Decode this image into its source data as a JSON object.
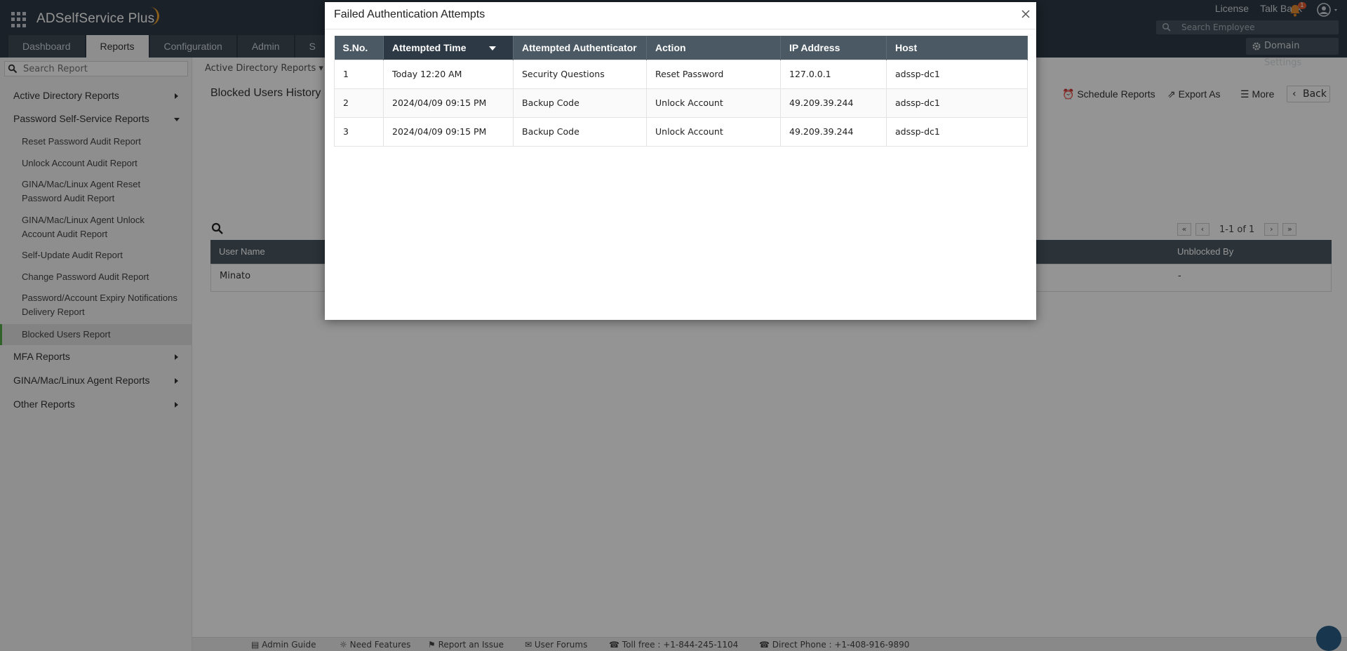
{
  "app": {
    "brand": "ADSelfService Plus"
  },
  "nav": {
    "tabs": [
      {
        "label": "Dashboard"
      },
      {
        "label": "Reports"
      },
      {
        "label": "Configuration"
      },
      {
        "label": "Admin"
      },
      {
        "label": "S"
      }
    ]
  },
  "top_links": {
    "license": "License",
    "talk_back": "Talk Back",
    "notification_count": "1"
  },
  "employee_search": {
    "placeholder": "Search Employee"
  },
  "domain_settings": {
    "label": "Domain Settings"
  },
  "sidebar": {
    "search_placeholder": "Search Report",
    "items": [
      {
        "label": "Active Directory Reports"
      },
      {
        "label": "Password Self-Service Reports"
      },
      {
        "label": "Reset Password Audit Report"
      },
      {
        "label": "Unlock Account Audit Report"
      },
      {
        "label": "GINA/Mac/Linux Agent Reset Password Audit Report"
      },
      {
        "label": "GINA/Mac/Linux Agent Unlock Account Audit Report"
      },
      {
        "label": "Self-Update Audit Report"
      },
      {
        "label": "Change Password Audit Report"
      },
      {
        "label": "Password/Account Expiry Notifications Delivery Report"
      },
      {
        "label": "Blocked Users Report"
      },
      {
        "label": "MFA Reports"
      },
      {
        "label": "GINA/Mac/Linux Agent Reports"
      },
      {
        "label": "Other Reports"
      }
    ]
  },
  "main": {
    "breadcrumb": "Active Directory Reports",
    "title": "Blocked Users History",
    "actions": {
      "schedule": "Schedule Reports",
      "export": "Export As",
      "more": "More",
      "back": "Back"
    },
    "pager": {
      "count": "1-1 of 1"
    },
    "columns": {
      "user_name": "User Name",
      "unblocked_by": "Unblocked By"
    },
    "rows": [
      {
        "user_name": "Minato",
        "unblocked_by": "-"
      }
    ]
  },
  "footer": {
    "admin_guide": "Admin Guide",
    "need_features": "Need Features",
    "report_issue": "Report an Issue",
    "user_forums": "User Forums",
    "toll_free": "Toll free : +1-844-245-1104",
    "direct_phone": "Direct Phone : +1-408-916-9890"
  },
  "modal": {
    "title": "Failed Authentication Attempts",
    "columns": [
      "S.No.",
      "Attempted Time",
      "Attempted Authenticator",
      "Action",
      "IP Address",
      "Host"
    ],
    "rows": [
      [
        "1",
        "Today 12:20 AM",
        "Security Questions",
        "Reset Password",
        "127.0.0.1",
        "adssp-dc1"
      ],
      [
        "2",
        "2024/04/09 09:15 PM",
        "Backup Code",
        "Unlock Account",
        "49.209.39.244",
        "adssp-dc1"
      ],
      [
        "3",
        "2024/04/09 09:15 PM",
        "Backup Code",
        "Unlock Account",
        "49.209.39.244",
        "adssp-dc1"
      ]
    ]
  },
  "colors": {
    "header_dark": "#2d3a45",
    "table_head": "#4a5963",
    "accent_green": "#55a948",
    "brand_orange": "#f0a32d"
  }
}
